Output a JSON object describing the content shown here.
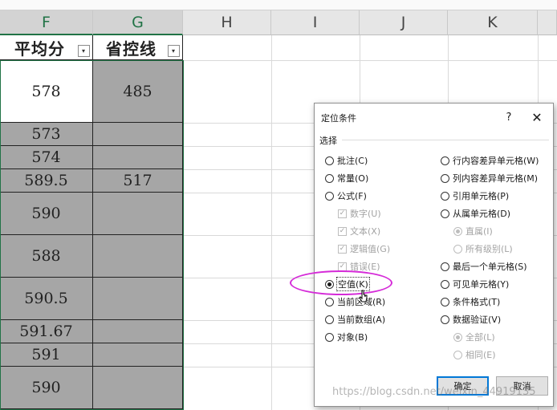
{
  "spreadsheet": {
    "columns": [
      "F",
      "G",
      "H",
      "I",
      "J",
      "K"
    ],
    "headers": {
      "f": "平均分",
      "g": "省控线"
    },
    "dropdown_glyph": "▾",
    "rows": [
      {
        "f": "578",
        "g": "485"
      },
      {
        "f": "573",
        "g": ""
      },
      {
        "f": "574",
        "g": ""
      },
      {
        "f": "589.5",
        "g": "517"
      },
      {
        "f": "590",
        "g": ""
      },
      {
        "f": "588",
        "g": ""
      },
      {
        "f": "590.5",
        "g": ""
      },
      {
        "f": "591.67",
        "g": ""
      },
      {
        "f": "591",
        "g": ""
      },
      {
        "f": "590",
        "g": ""
      }
    ],
    "colors": {
      "selection_fill": "#a6a6a6",
      "selection_border": "#217346"
    }
  },
  "dialog": {
    "title": "定位条件",
    "help_glyph": "?",
    "close_glyph": "✕",
    "group_label": "选择",
    "left_options": {
      "comments": "批注(C)",
      "constants": "常量(O)",
      "formulas": "公式(F)",
      "numbers": "数字(U)",
      "text": "文本(X)",
      "logicals": "逻辑值(G)",
      "errors": "错误(E)",
      "blanks": "空值(K)",
      "current_region": "当前区域(R)",
      "current_array": "当前数组(A)",
      "objects": "对象(B)"
    },
    "right_options": {
      "row_differences": "行内容差异单元格(W)",
      "column_differences": "列内容差异单元格(M)",
      "precedents": "引用单元格(P)",
      "dependents": "从属单元格(D)",
      "direct_only": "直属(I)",
      "all_levels": "所有级别(L)",
      "last_cell": "最后一个单元格(S)",
      "visible_cells": "可见单元格(Y)",
      "conditional_formats": "条件格式(T)",
      "data_validation": "数据验证(V)",
      "all": "全部(L)",
      "same": "相同(E)"
    },
    "selected_option": "blanks",
    "ok_label": "确定",
    "cancel_label": "取消",
    "highlight_color": "#d52ad8"
  },
  "watermark": "https://blog.csdn.net/weixin_44919135"
}
